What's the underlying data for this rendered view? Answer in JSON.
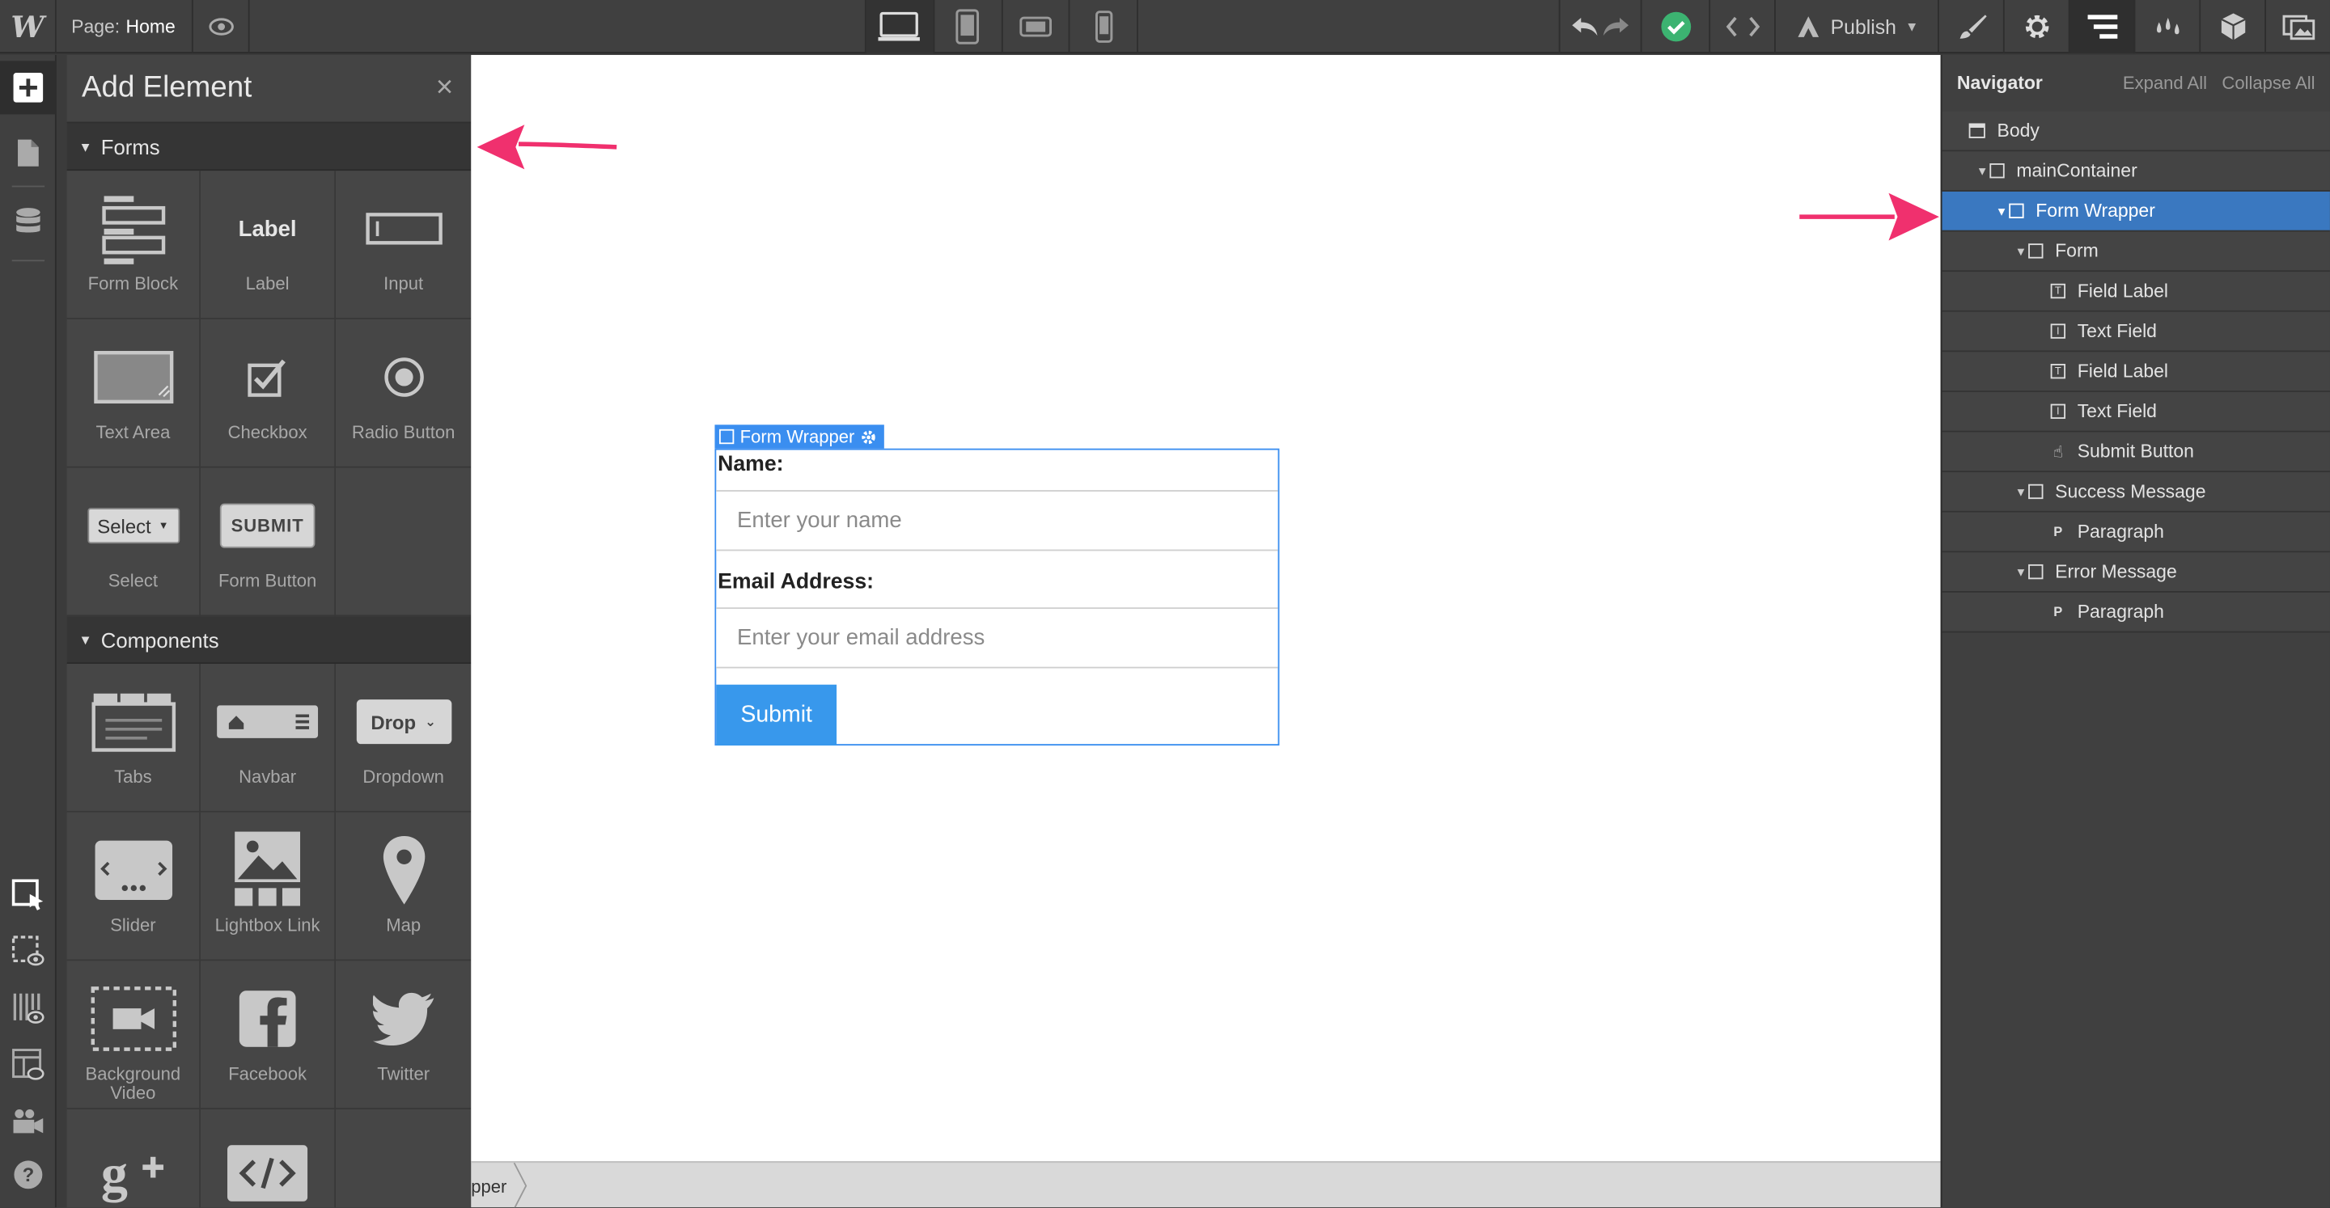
{
  "topbar": {
    "logo": "W",
    "page_prefix": "Page:",
    "page_name": "Home",
    "publish_label": "Publish",
    "devices": [
      "desktop-icon",
      "tablet-icon",
      "mobile-landscape-icon",
      "mobile-portrait-icon"
    ]
  },
  "panel": {
    "title": "Add Element",
    "close": "×",
    "sections": [
      {
        "name": "Forms",
        "items": [
          "Form Block",
          "Label",
          "Input",
          "Text Area",
          "Checkbox",
          "Radio Button",
          "Select",
          "Form Button"
        ]
      },
      {
        "name": "Components",
        "items": [
          "Tabs",
          "Navbar",
          "Dropdown",
          "Slider",
          "Lightbox Link",
          "Map",
          "Background Video",
          "Facebook",
          "Twitter"
        ]
      }
    ],
    "tile_text": {
      "label": "Label",
      "select": "Select",
      "submit": "SUBMIT",
      "drop": "Drop"
    }
  },
  "canvas": {
    "selection_tag": "Form Wrapper",
    "form": {
      "name_label": "Name:",
      "name_placeholder": "Enter your name",
      "email_label": "Email Address:",
      "email_placeholder": "Enter your email address",
      "submit_label": "Submit"
    },
    "breadcrumb": "pper"
  },
  "navigator": {
    "title": "Navigator",
    "expand_all": "Expand All",
    "collapse_all": "Collapse All",
    "rows": [
      {
        "label": "Body"
      },
      {
        "label": "mainContainer"
      },
      {
        "label": "Form Wrapper"
      },
      {
        "label": "Form"
      },
      {
        "label": "Field Label"
      },
      {
        "label": "Text Field"
      },
      {
        "label": "Field Label"
      },
      {
        "label": "Text Field"
      },
      {
        "label": "Submit Button"
      },
      {
        "label": "Success Message"
      },
      {
        "label": "Paragraph"
      },
      {
        "label": "Error Message"
      },
      {
        "label": "Paragraph"
      }
    ]
  },
  "colors": {
    "accent": "#3a8ef0",
    "selected_row": "#3a78c0",
    "arrow": "#f0306e",
    "status_ok": "#3cb371"
  }
}
